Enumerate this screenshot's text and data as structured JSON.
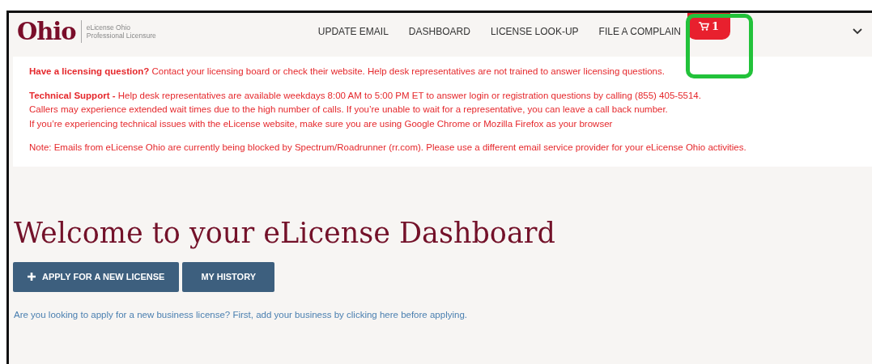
{
  "header": {
    "logo": "Ohio",
    "logo_subtitle": [
      "eLicense Ohio",
      "Professional Licensure"
    ],
    "nav": [
      {
        "label": "UPDATE EMAIL"
      },
      {
        "label": "DASHBOARD"
      },
      {
        "label": "LICENSE LOOK-UP"
      },
      {
        "label": "FILE A COMPLAIN"
      }
    ],
    "cart": {
      "count": "1",
      "highlighted": true
    }
  },
  "notice": [
    [
      "**Have a licensing question?** Contact your licensing board or check their website. Help desk representatives are not trained to answer licensing questions."
    ],
    [
      "**Technical Support -** Help desk representatives are available weekdays 8:00 AM to 5:00 PM ET to answer login or registration questions by calling (855) 405-5514.",
      "Callers may experience extended wait times due to the high number of calls. If you’re unable to wait for a representative, you can leave a call back number.",
      "If you’re experiencing technical issues with the eLicense website, make sure you are using Google Chrome or Mozilla Firefox as your browser"
    ],
    [
      "Note: Emails from eLicense Ohio are currently being blocked by Spectrum/Roadrunner (rr.com). Please use a different email service provider for your eLicense Ohio activities."
    ]
  ],
  "title": "Welcome to your eLicense Dashboard",
  "buttons": [
    {
      "label": "APPLY FOR A NEW LICENSE",
      "kind": "add"
    },
    {
      "label": "MY HISTORY",
      "kind": "plain"
    }
  ],
  "link": "Are you looking to apply for a new business license? First, add your business by clicking here before applying."
}
